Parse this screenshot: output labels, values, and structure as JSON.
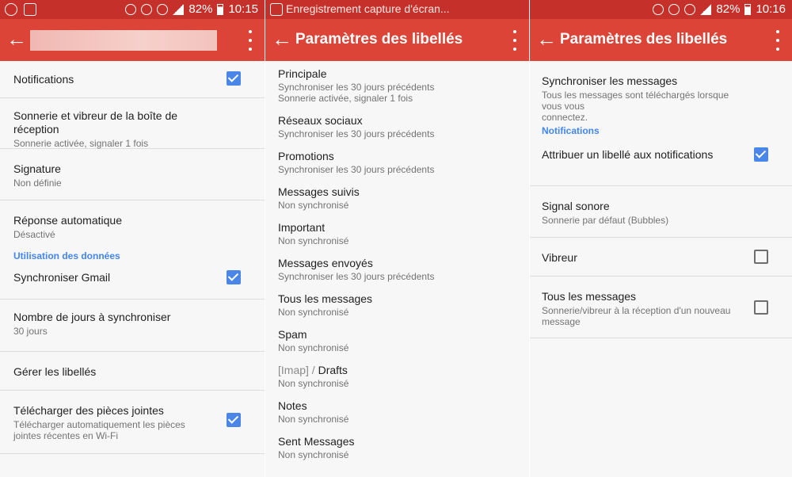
{
  "screens": [
    {
      "status": {
        "battery": "82%",
        "time": "10:15"
      },
      "items": [
        {
          "title": "Notifications",
          "checked": true
        },
        {
          "title": "Sonnerie et vibreur de la boîte de réception",
          "subtitle": "Sonnerie activée, signaler 1 fois"
        },
        {
          "title": "Signature",
          "subtitle": "Non définie"
        },
        {
          "title": "Réponse automatique",
          "subtitle": "Désactivé"
        }
      ],
      "section": "Utilisation des données",
      "items2": [
        {
          "title": "Synchroniser Gmail",
          "checked": true
        },
        {
          "title": "Nombre de jours à synchroniser",
          "subtitle": "30 jours"
        },
        {
          "title": "Gérer les libellés"
        },
        {
          "title": "Télécharger des pièces jointes",
          "subtitle": "Télécharger automatiquement les pièces",
          "subtitle2": "jointes récentes en Wi-Fi",
          "checked": true
        }
      ]
    },
    {
      "status": {
        "notification": "Enregistrement capture d'écran..."
      },
      "title": "Paramètres des libellés",
      "labels": [
        {
          "title": "Principale",
          "subtitle": "Synchroniser les 30 jours précédents",
          "subtitle2": "Sonnerie activée, signaler 1 fois"
        },
        {
          "title": "Réseaux sociaux",
          "subtitle": "Synchroniser les 30 jours précédents"
        },
        {
          "title": "Promotions",
          "subtitle": "Synchroniser les 30 jours précédents"
        },
        {
          "title": "Messages suivis",
          "subtitle": "Non synchronisé"
        },
        {
          "title": "Important",
          "subtitle": "Non synchronisé"
        },
        {
          "title": "Messages envoyés",
          "subtitle": "Synchroniser les 30 jours précédents"
        },
        {
          "title": "Tous les messages",
          "subtitle": "Non synchronisé"
        },
        {
          "title": "Spam",
          "subtitle": "Non synchronisé"
        },
        {
          "title_prefix": "[Imap] / ",
          "title": "Drafts",
          "subtitle": "Non synchronisé"
        },
        {
          "title": "Notes",
          "subtitle": "Non synchronisé"
        },
        {
          "title": "Sent Messages",
          "subtitle": "Non synchronisé"
        }
      ]
    },
    {
      "status": {
        "battery": "82%",
        "time": "10:16"
      },
      "title": "Paramètres des libellés",
      "sync": {
        "title": "Synchroniser les messages",
        "subtitle": "Tous les messages sont téléchargés lorsque vous vous",
        "subtitle2": "connectez."
      },
      "section": "Notifications",
      "items": [
        {
          "title": "Attribuer un libellé aux notifications",
          "checked": true
        },
        {
          "title": "Signal sonore",
          "subtitle": "Sonnerie par défaut (Bubbles)"
        },
        {
          "title": "Vibreur",
          "checked": false
        },
        {
          "title": "Tous les messages",
          "subtitle": "Sonnerie/vibreur à la réception d'un nouveau",
          "subtitle2": "message",
          "checked": false
        }
      ]
    }
  ],
  "colors": {
    "toolbar": "#db4437",
    "statusbar": "#c6302a",
    "accent": "#4285f4",
    "checkbox": "#4a86e8"
  }
}
